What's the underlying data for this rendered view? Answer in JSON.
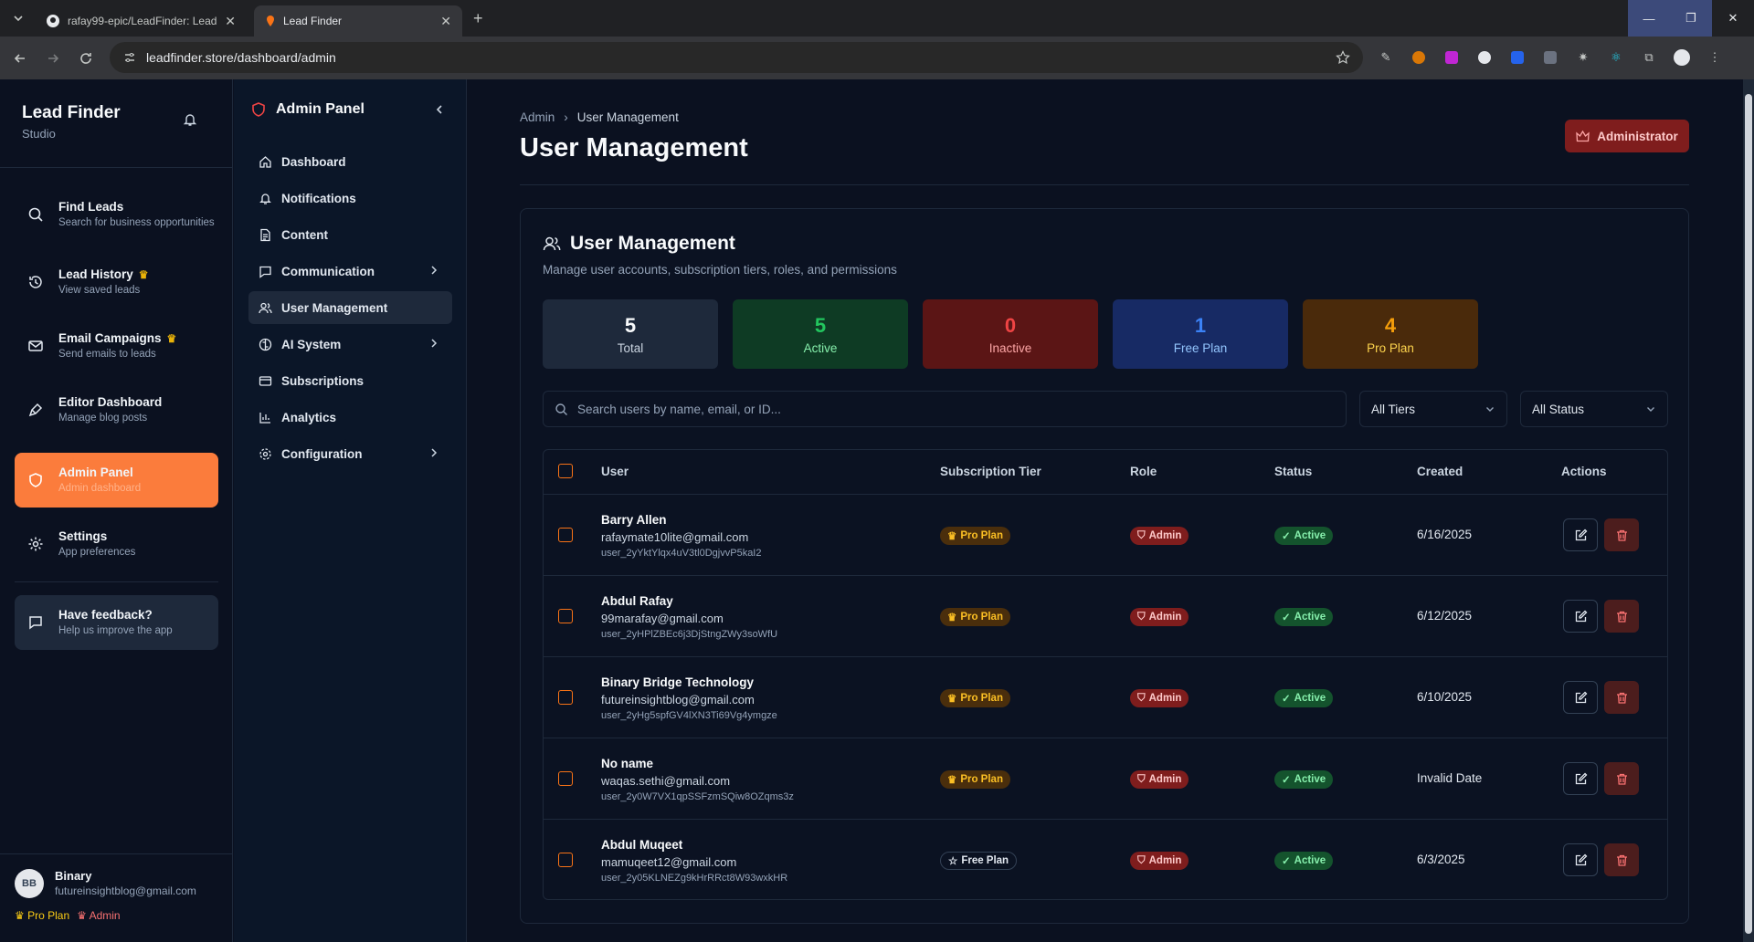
{
  "browser": {
    "tabs": [
      {
        "title": "rafay99-epic/LeadFinder: Lead ·",
        "icon": "github-icon"
      },
      {
        "title": "Lead Finder",
        "icon": "map-pin-icon"
      }
    ],
    "url": "leadfinder.store/dashboard/admin"
  },
  "sidebar": {
    "brand_title": "Lead Finder",
    "brand_sub": "Studio",
    "items": [
      {
        "title": "Find Leads",
        "sub": "Search for business opportunities"
      },
      {
        "title": "Lead History",
        "sub": "View saved leads"
      },
      {
        "title": "Email Campaigns",
        "sub": "Send emails to leads"
      },
      {
        "title": "Editor Dashboard",
        "sub": "Manage blog posts"
      },
      {
        "title": "Admin Panel",
        "sub": "Admin dashboard"
      },
      {
        "title": "Settings",
        "sub": "App preferences"
      }
    ],
    "feedback": {
      "title": "Have feedback?",
      "sub": "Help us improve the app"
    },
    "user": {
      "name": "Binary",
      "email": "futureinsightblog@gmail.com",
      "pro_label": "Pro Plan",
      "admin_label": "Admin"
    }
  },
  "admin_nav": {
    "title": "Admin Panel",
    "items": [
      "Dashboard",
      "Notifications",
      "Content",
      "Communication",
      "User Management",
      "AI System",
      "Subscriptions",
      "Analytics",
      "Configuration"
    ]
  },
  "main": {
    "breadcrumb": [
      "Admin",
      "User Management"
    ],
    "title": "User Management",
    "role_badge": "Administrator",
    "card": {
      "title": "User Management",
      "subtitle": "Manage user accounts, subscription tiers, roles, and permissions"
    },
    "stats": [
      {
        "value": "5",
        "label": "Total"
      },
      {
        "value": "5",
        "label": "Active"
      },
      {
        "value": "0",
        "label": "Inactive"
      },
      {
        "value": "1",
        "label": "Free Plan"
      },
      {
        "value": "4",
        "label": "Pro Plan"
      }
    ],
    "search_placeholder": "Search users by name, email, or ID...",
    "filter_tiers": "All Tiers",
    "filter_status": "All Status",
    "columns": [
      "User",
      "Subscription Tier",
      "Role",
      "Status",
      "Created",
      "Actions"
    ],
    "users": [
      {
        "name": "Barry Allen",
        "email": "rafaymate10lite@gmail.com",
        "id": "user_2yYktYlqx4uV3tl0DgjvvP5kaI2",
        "tier": "Pro Plan",
        "role": "Admin",
        "status": "Active",
        "created": "6/16/2025"
      },
      {
        "name": "Abdul Rafay",
        "email": "99marafay@gmail.com",
        "id": "user_2yHPlZBEc6j3DjStngZWy3soWfU",
        "tier": "Pro Plan",
        "role": "Admin",
        "status": "Active",
        "created": "6/12/2025"
      },
      {
        "name": "Binary Bridge Technology",
        "email": "futureinsightblog@gmail.com",
        "id": "user_2yHg5spfGV4lXN3Ti69Vg4ymgze",
        "tier": "Pro Plan",
        "role": "Admin",
        "status": "Active",
        "created": "6/10/2025"
      },
      {
        "name": "No name",
        "email": "waqas.sethi@gmail.com",
        "id": "user_2y0W7VX1qpSSFzmSQiw8OZqms3z",
        "tier": "Pro Plan",
        "role": "Admin",
        "status": "Active",
        "created": "Invalid Date"
      },
      {
        "name": "Abdul Muqeet",
        "email": "mamuqeet12@gmail.com",
        "id": "user_2y05KLNEZg9kHrRRct8W93wxkHR",
        "tier": "Free Plan",
        "role": "Admin",
        "status": "Active",
        "created": "6/3/2025"
      }
    ]
  },
  "colors": {
    "accent": "#fb7c3c",
    "admin": "#7f1d1d",
    "active": "#14532d",
    "pro": "#fbbf24"
  }
}
